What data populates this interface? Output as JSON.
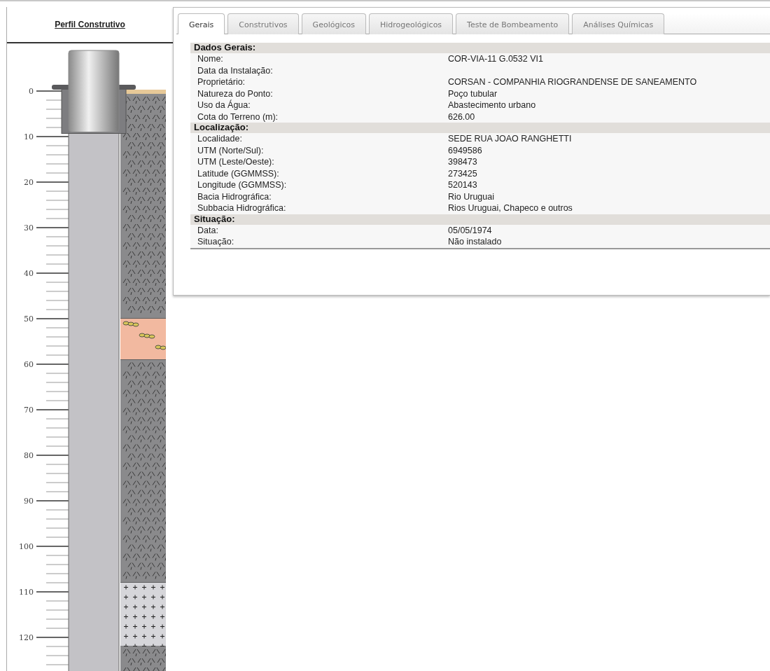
{
  "profile": {
    "title": "Perfil Construtivo",
    "depth_labels": [
      "0",
      "10",
      "20",
      "30",
      "40",
      "50",
      "60",
      "70",
      "80",
      "90",
      "100",
      "110",
      "120"
    ]
  },
  "tabs": [
    {
      "label": "Gerais",
      "selected": true
    },
    {
      "label": "Construtivos",
      "selected": false
    },
    {
      "label": "Geológicos",
      "selected": false
    },
    {
      "label": "Hidrogeológicos",
      "selected": false
    },
    {
      "label": "Teste de Bombeamento",
      "selected": false
    },
    {
      "label": "Análises Químicas",
      "selected": false
    }
  ],
  "sections": [
    {
      "title": "Dados Gerais:",
      "rows": [
        {
          "label": "Nome:",
          "value": "COR-VIA-11 G.0532 VI1"
        },
        {
          "label": "Data da Instalação:",
          "value": ""
        },
        {
          "label": "Proprietário:",
          "value": "CORSAN - COMPANHIA RIOGRANDENSE DE SANEAMENTO"
        },
        {
          "label": "Natureza do Ponto:",
          "value": "Poço tubular"
        },
        {
          "label": "Uso da Água:",
          "value": "Abastecimento urbano"
        },
        {
          "label": "Cota do Terreno (m):",
          "value": "626.00"
        }
      ]
    },
    {
      "title": "Localização:",
      "rows": [
        {
          "label": "Localidade:",
          "value": "SEDE RUA JOAO RANGHETTI"
        },
        {
          "label": "UTM (Norte/Sul):",
          "value": "6949586"
        },
        {
          "label": "UTM (Leste/Oeste):",
          "value": "398473"
        },
        {
          "label": "Latitude (GGMMSS):",
          "value": "273425"
        },
        {
          "label": "Longitude (GGMMSS):",
          "value": "520143"
        },
        {
          "label": "Bacia Hidrográfica:",
          "value": "Rio Uruguai"
        },
        {
          "label": "Subbacia Hidrográfica:",
          "value": "Rios Uruguai, Chapeco e outros"
        }
      ]
    },
    {
      "title": "Situação:",
      "rows": [
        {
          "label": "Data:",
          "value": "05/05/1974"
        },
        {
          "label": "Situação:",
          "value": "Não instalado"
        }
      ]
    }
  ]
}
